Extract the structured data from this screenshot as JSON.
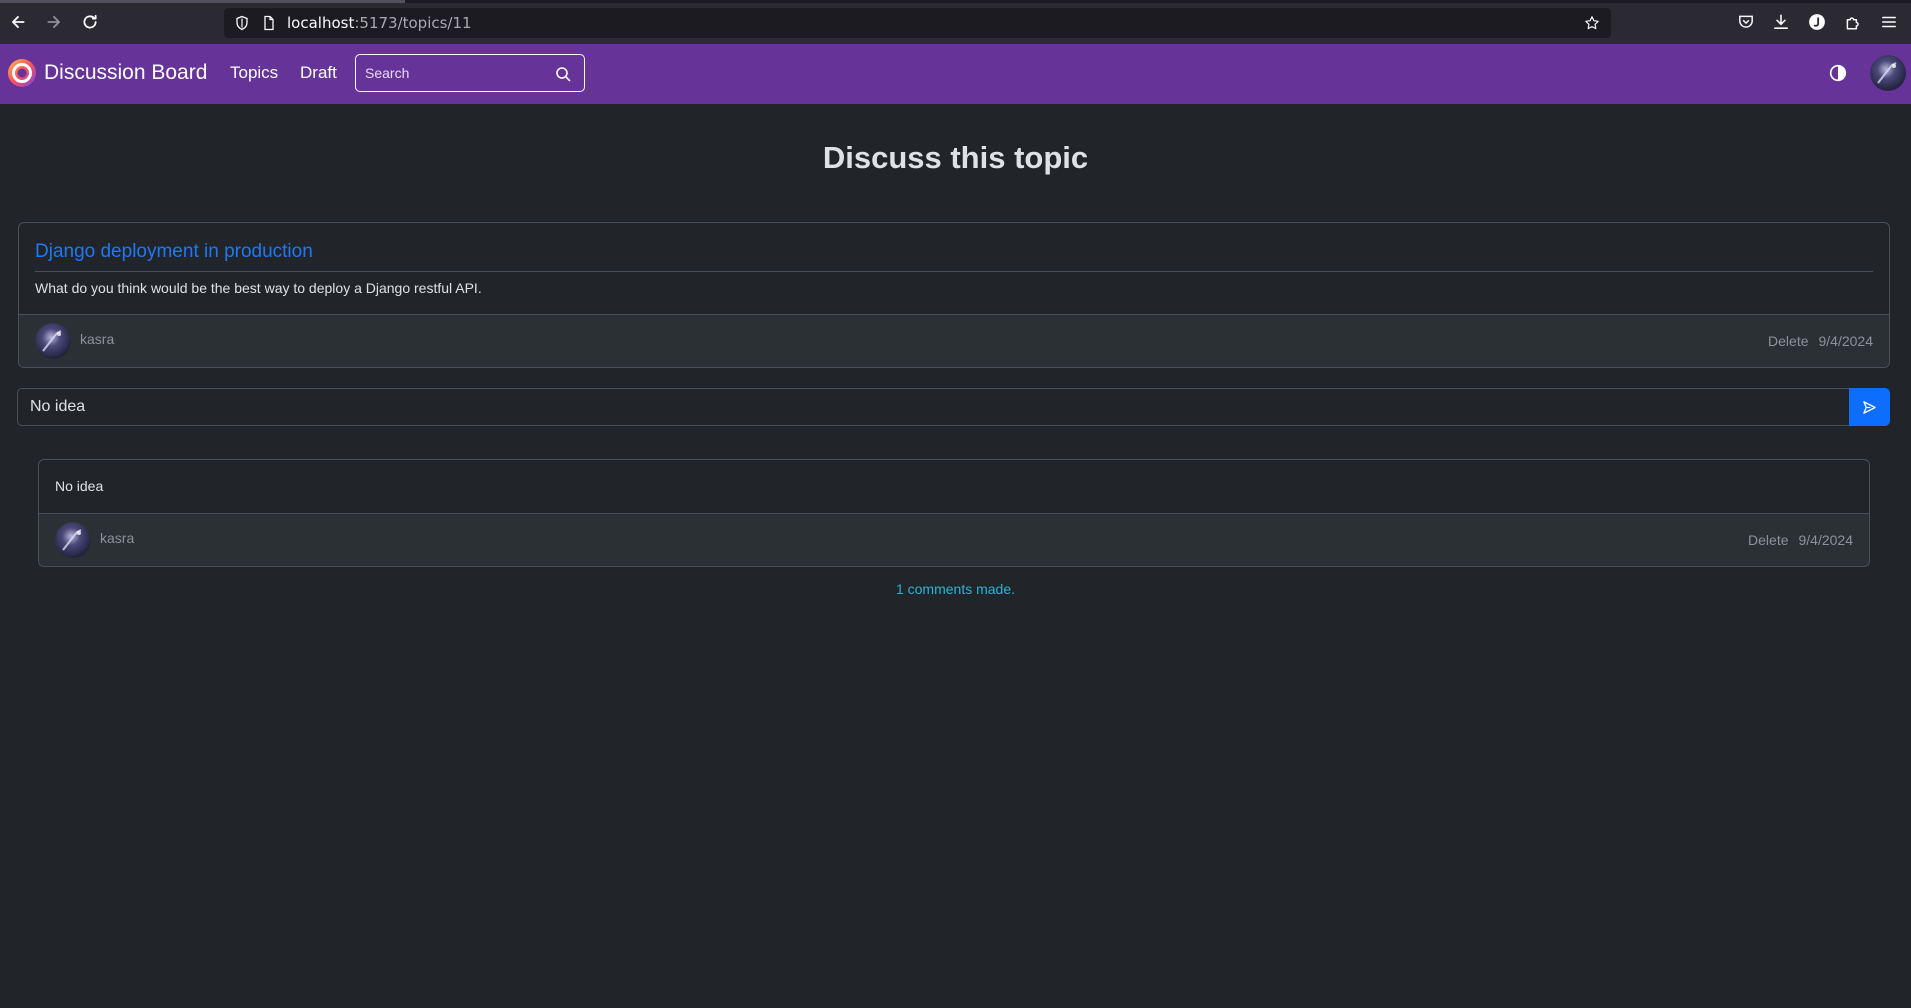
{
  "browser": {
    "url_host": "localhost",
    "url_path": ":5173/topics/11"
  },
  "navbar": {
    "brand": "Discussion Board",
    "links": [
      {
        "label": "Topics"
      },
      {
        "label": "Draft"
      }
    ],
    "search_placeholder": "Search"
  },
  "page": {
    "title": "Discuss this topic"
  },
  "topic": {
    "title": "Django deployment in production",
    "body": "What do you think would be the best way to deploy a Django restful API.",
    "author": "kasra",
    "delete_label": "Delete",
    "date": "9/4/2024"
  },
  "comment_form": {
    "value": "No idea"
  },
  "comments": [
    {
      "body": "No idea",
      "author": "kasra",
      "delete_label": "Delete",
      "date": "9/4/2024"
    }
  ],
  "comments_count_text": "1 comments made.",
  "colors": {
    "navbar": "#663399",
    "background": "#212529",
    "link": "#1e78f5",
    "primary_button": "#0d6efd",
    "info_text": "#2bb3d6"
  }
}
